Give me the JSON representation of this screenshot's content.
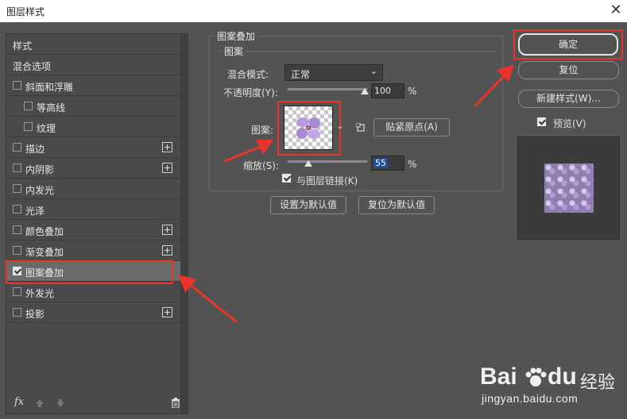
{
  "window": {
    "title": "图层样式"
  },
  "sidebar": {
    "header": "样式",
    "blend_options": "混合选项",
    "items": [
      {
        "label": "斜面和浮雕",
        "checked": false,
        "plus": false,
        "indent": 0
      },
      {
        "label": "等高线",
        "checked": false,
        "plus": false,
        "indent": 1
      },
      {
        "label": "纹理",
        "checked": false,
        "plus": false,
        "indent": 1
      },
      {
        "label": "描边",
        "checked": false,
        "plus": true,
        "indent": 0
      },
      {
        "label": "内阴影",
        "checked": false,
        "plus": true,
        "indent": 0
      },
      {
        "label": "内发光",
        "checked": false,
        "plus": false,
        "indent": 0
      },
      {
        "label": "光泽",
        "checked": false,
        "plus": false,
        "indent": 0
      },
      {
        "label": "颜色叠加",
        "checked": false,
        "plus": true,
        "indent": 0
      },
      {
        "label": "渐变叠加",
        "checked": false,
        "plus": true,
        "indent": 0
      },
      {
        "label": "图案叠加",
        "checked": true,
        "plus": false,
        "indent": 0,
        "selected": true
      },
      {
        "label": "外发光",
        "checked": false,
        "plus": false,
        "indent": 0
      },
      {
        "label": "投影",
        "checked": false,
        "plus": true,
        "indent": 0
      }
    ],
    "fx_label": "fx"
  },
  "main": {
    "group_title": "图案叠加",
    "subgroup_title": "图案",
    "blend_mode_label": "混合模式:",
    "blend_mode_value": "正常",
    "opacity_label": "不透明度(Y):",
    "opacity_value": "100",
    "opacity_unit": "%",
    "opacity_level": 1.0,
    "pattern_label": "图案:",
    "snap_origin_button": "贴紧原点(A)",
    "scale_label": "缩放(S):",
    "scale_value": "55",
    "scale_unit": "%",
    "link_with_layer_label": "与图层链接(K)",
    "link_with_layer_checked": true,
    "set_default_button": "设置为默认值",
    "reset_default_button": "复位为默认值"
  },
  "right": {
    "ok_button": "确定",
    "reset_button": "复位",
    "new_style_button": "新建样式(W)...",
    "preview_label": "预览(V)",
    "preview_checked": true
  },
  "watermark": {
    "brand": "Bai",
    "brand2": "du",
    "cn": "经验",
    "url": "jingyan.baidu.com"
  },
  "colors": {
    "highlight": "#e8342b",
    "panel": "#535353",
    "selected_row": "#6b6b6b",
    "input_active": "#1f4ea0"
  }
}
